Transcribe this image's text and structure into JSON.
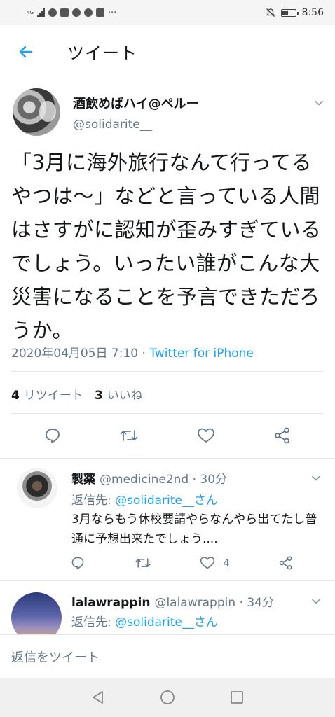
{
  "status_bar": {
    "network": "4G",
    "time": "8:56"
  },
  "header": {
    "title": "ツイート"
  },
  "tweet": {
    "display_name": "酒飲めばハイ@ペルー",
    "handle": "@solidarite__",
    "text": "「3月に海外旅行なんて行ってるやつは〜」などと言っている人間はさすがに認知が歪みすぎているでしょう。いったい誰がこんな大災害になることを予言できただろうか。",
    "timestamp": "2020年04月05日 7:10",
    "separator": " · ",
    "source": "Twitter for iPhone",
    "retweet_count": "4",
    "retweet_label": "リツイート",
    "like_count": "3",
    "like_label": "いいね"
  },
  "replies": [
    {
      "display_name": "製薬",
      "handle_time": "@medicine2nd · 30分",
      "reply_to_label": "返信先: ",
      "reply_to_handle": "@solidarite__さん",
      "text": "3月ならもう休校要請やらなんやら出てたし普通に予想出来たでしょう....",
      "like_count": "4"
    },
    {
      "display_name": "lalawrappin",
      "handle_time": "@lalawrappin · 34分",
      "reply_to_label": "返信先: ",
      "reply_to_handle": "@solidarite__さん"
    }
  ],
  "compose": {
    "placeholder": "返信をツイート"
  },
  "colors": {
    "accent": "#1da1f2",
    "secondary_text": "#657786",
    "primary_text": "#14171a"
  },
  "icons": [
    "back-arrow-icon",
    "chevron-down-icon",
    "reply-icon",
    "retweet-icon",
    "like-icon",
    "share-icon",
    "nav-back-icon",
    "nav-home-icon",
    "nav-recents-icon"
  ]
}
